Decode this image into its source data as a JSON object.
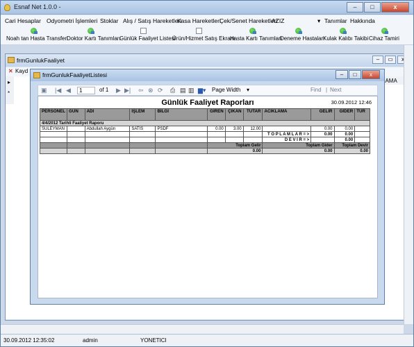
{
  "app": {
    "title": "Esnaf Net 1.0.0 -",
    "window_buttons": [
      "–",
      "□",
      "x"
    ]
  },
  "menu": {
    "items": [
      "Cari Hesaplar",
      "Odyometri İşlemleri",
      "Stoklar",
      "Alış / Satış Hareketleri",
      "Kasa Hareketleri",
      "Çek/Senet Hareketleri",
      "AZIZ",
      "Tanımlar",
      "Hakkında"
    ]
  },
  "toolbar": {
    "items": [
      "Noah tan Hasta Transferi",
      "Doktor Kartı Tanımları",
      "Günlük Faaliyet Listesi",
      "Ürün/Hizmet Satış Ekranı",
      "Hasta Kartı Tanımları",
      "Deneme Hastaları",
      "Kulak Kalıbı Takibi",
      "Cihaz Tamiri"
    ]
  },
  "win1": {
    "title": "frmGunlukFaaliyet",
    "strip_text": "Kayd",
    "grid_header": "LAMA",
    "row_markers": [
      "▸",
      "*"
    ]
  },
  "win2": {
    "title": "frmGunlukFaaliyetListesi",
    "report_toolbar": {
      "page": "1",
      "of_pages": "of 1",
      "zoom": "Page Width",
      "find": "Find",
      "next": "Next"
    }
  },
  "report": {
    "title": "Günlük Faaliyet Raporları",
    "date": "30.09.2012 12:46",
    "columns": [
      "PERSONEL",
      "GÜN",
      "ADI",
      "İŞLEM",
      "BİLGİ",
      "GİREN",
      "ÇIKAN",
      "TUTAR",
      "ACIKLAMA",
      "GELİR",
      "GİDER",
      "TÜR"
    ],
    "group_label": "4/4/2012 Tarihli Faaliyet Raporu",
    "rows": [
      [
        "SULEYMAN",
        "",
        "Abdullah Aygün",
        "SATIS",
        "PSDF",
        "0.00",
        "3.00",
        "12.00",
        "",
        "0.00",
        "0.00",
        ""
      ]
    ],
    "totals_label": "T O P L A M L A R = >",
    "totals": [
      "0.00",
      "0.00"
    ],
    "devir_label": "D E V İ R = >",
    "devir": "0.00",
    "footer_headers": [
      "Toplam Gelir",
      "Toplam Gider",
      "Toplam Devir"
    ],
    "footer_values": [
      "0.00",
      "0.00",
      "0.00"
    ]
  },
  "status": {
    "datetime": "30.09.2012 12:35:02",
    "user": "admin",
    "role": "YONETICI"
  }
}
